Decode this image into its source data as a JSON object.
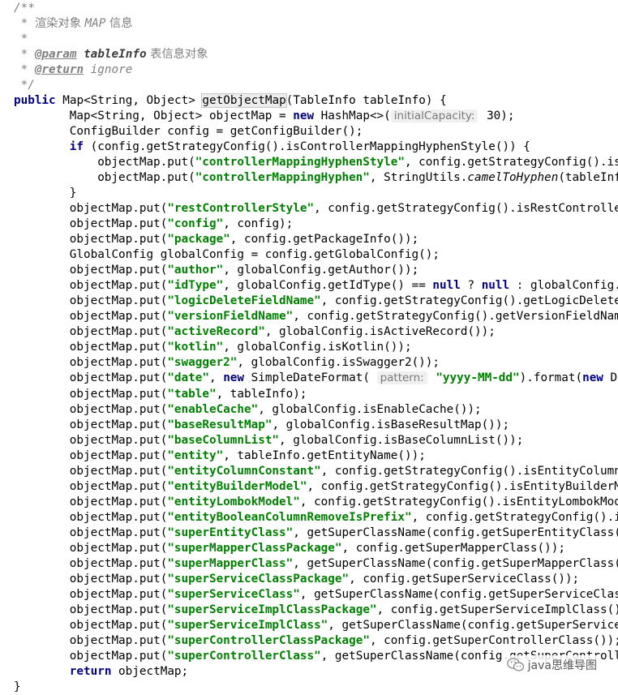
{
  "colors": {
    "keyword": "#000080",
    "string": "#008000",
    "comment": "#808080",
    "hint_background": "#f0f0f0",
    "highlight_background": "#ededed"
  },
  "watermark": {
    "text": "java思维导图",
    "icon": "wechat-icon"
  },
  "code": [
    {
      "indent": 0,
      "tokens": [
        {
          "t": "/**",
          "c": "c"
        }
      ]
    },
    {
      "indent": 1,
      "tokens": [
        {
          "t": "* ",
          "c": "c"
        },
        {
          "t": "渲染对象 ",
          "c": "cj"
        },
        {
          "t": "MAP",
          "c": "c"
        },
        {
          "t": " 信息",
          "c": "cj"
        }
      ]
    },
    {
      "indent": 1,
      "tokens": [
        {
          "t": "*",
          "c": "c"
        }
      ]
    },
    {
      "indent": 1,
      "tokens": [
        {
          "t": "* ",
          "c": "c"
        },
        {
          "t": "@param",
          "c": "ct"
        },
        {
          "t": " ",
          "c": "c"
        },
        {
          "t": "tableInfo",
          "c": "cb"
        },
        {
          "t": " 表信息对象",
          "c": "cj"
        }
      ]
    },
    {
      "indent": 1,
      "tokens": [
        {
          "t": "* ",
          "c": "c"
        },
        {
          "t": "@return",
          "c": "ct"
        },
        {
          "t": " ignore",
          "c": "c"
        }
      ]
    },
    {
      "indent": 1,
      "tokens": [
        {
          "t": "*/",
          "c": "c"
        }
      ]
    },
    {
      "indent": 0,
      "tokens": [
        {
          "t": "public",
          "c": "k"
        },
        {
          "t": " Map<String, Object> "
        },
        {
          "t": "caret",
          "c": "caret"
        },
        {
          "t": "getObjectMap",
          "c": "hl"
        },
        {
          "t": "(TableInfo tableInfo) {"
        }
      ]
    },
    {
      "indent": 8,
      "tokens": [
        {
          "t": "Map<String, Object> objectMap = "
        },
        {
          "t": "new",
          "c": "k"
        },
        {
          "t": " HashMap<>("
        },
        {
          "t": "initialCapacity:",
          "c": "hint"
        },
        {
          "t": " 30);"
        }
      ]
    },
    {
      "indent": 8,
      "tokens": [
        {
          "t": "ConfigBuilder config = getConfigBuilder();"
        }
      ]
    },
    {
      "indent": 8,
      "tokens": [
        {
          "t": "if",
          "c": "k"
        },
        {
          "t": " (config.getStrategyConfig().isControllerMappingHyphenStyle()) {"
        }
      ]
    },
    {
      "indent": 12,
      "tokens": [
        {
          "t": "objectMap.put("
        },
        {
          "t": "\"controllerMappingHyphenStyle\"",
          "c": "s"
        },
        {
          "t": ", config.getStrategyConfig().isControllerMappingHyphenStyle());"
        }
      ]
    },
    {
      "indent": 12,
      "tokens": [
        {
          "t": "objectMap.put("
        },
        {
          "t": "\"controllerMappingHyphen\"",
          "c": "s"
        },
        {
          "t": ", StringUtils."
        },
        {
          "t": "camelToHyphen",
          "c": "i"
        },
        {
          "t": "(tableInfo.getEntityPath()));"
        }
      ]
    },
    {
      "indent": 8,
      "tokens": [
        {
          "t": "}"
        }
      ]
    },
    {
      "indent": 8,
      "tokens": [
        {
          "t": "objectMap.put("
        },
        {
          "t": "\"restControllerStyle\"",
          "c": "s"
        },
        {
          "t": ", config.getStrategyConfig().isRestControllerStyle());"
        }
      ]
    },
    {
      "indent": 8,
      "tokens": [
        {
          "t": "objectMap.put("
        },
        {
          "t": "\"config\"",
          "c": "s"
        },
        {
          "t": ", config);"
        }
      ]
    },
    {
      "indent": 8,
      "tokens": [
        {
          "t": "objectMap.put("
        },
        {
          "t": "\"package\"",
          "c": "s"
        },
        {
          "t": ", config.getPackageInfo());"
        }
      ]
    },
    {
      "indent": 8,
      "tokens": [
        {
          "t": "GlobalConfig globalConfig = config.getGlobalConfig();"
        }
      ]
    },
    {
      "indent": 8,
      "tokens": [
        {
          "t": "objectMap.put("
        },
        {
          "t": "\"author\"",
          "c": "s"
        },
        {
          "t": ", globalConfig.getAuthor());"
        }
      ]
    },
    {
      "indent": 8,
      "tokens": [
        {
          "t": "objectMap.put("
        },
        {
          "t": "\"idType\"",
          "c": "s"
        },
        {
          "t": ", globalConfig.getIdType() == "
        },
        {
          "t": "null",
          "c": "k"
        },
        {
          "t": " ? "
        },
        {
          "t": "null",
          "c": "k"
        },
        {
          "t": " : globalConfig.getIdType().toString());"
        }
      ]
    },
    {
      "indent": 8,
      "tokens": [
        {
          "t": "objectMap.put("
        },
        {
          "t": "\"logicDeleteFieldName\"",
          "c": "s"
        },
        {
          "t": ", config.getStrategyConfig().getLogicDeleteFieldName());"
        }
      ]
    },
    {
      "indent": 8,
      "tokens": [
        {
          "t": "objectMap.put("
        },
        {
          "t": "\"versionFieldName\"",
          "c": "s"
        },
        {
          "t": ", config.getStrategyConfig().getVersionFieldName());"
        }
      ]
    },
    {
      "indent": 8,
      "tokens": [
        {
          "t": "objectMap.put("
        },
        {
          "t": "\"activeRecord\"",
          "c": "s"
        },
        {
          "t": ", globalConfig.isActiveRecord());"
        }
      ]
    },
    {
      "indent": 8,
      "tokens": [
        {
          "t": "objectMap.put("
        },
        {
          "t": "\"kotlin\"",
          "c": "s"
        },
        {
          "t": ", globalConfig.isKotlin());"
        }
      ]
    },
    {
      "indent": 8,
      "tokens": [
        {
          "t": "objectMap.put("
        },
        {
          "t": "\"swagger2\"",
          "c": "s"
        },
        {
          "t": ", globalConfig.isSwagger2());"
        }
      ]
    },
    {
      "indent": 8,
      "tokens": [
        {
          "t": "objectMap.put("
        },
        {
          "t": "\"date\"",
          "c": "s"
        },
        {
          "t": ", "
        },
        {
          "t": "new",
          "c": "k"
        },
        {
          "t": " SimpleDateFormat( "
        },
        {
          "t": "pattern:",
          "c": "hint"
        },
        {
          "t": " "
        },
        {
          "t": "\"yyyy-MM-dd\"",
          "c": "s"
        },
        {
          "t": ").format("
        },
        {
          "t": "new",
          "c": "k"
        },
        {
          "t": " Date()));"
        }
      ]
    },
    {
      "indent": 8,
      "tokens": [
        {
          "t": "objectMap.put("
        },
        {
          "t": "\"table\"",
          "c": "s"
        },
        {
          "t": ", tableInfo);"
        }
      ]
    },
    {
      "indent": 8,
      "tokens": [
        {
          "t": "objectMap.put("
        },
        {
          "t": "\"enableCache\"",
          "c": "s"
        },
        {
          "t": ", globalConfig.isEnableCache());"
        }
      ]
    },
    {
      "indent": 8,
      "tokens": [
        {
          "t": "objectMap.put("
        },
        {
          "t": "\"baseResultMap\"",
          "c": "s"
        },
        {
          "t": ", globalConfig.isBaseResultMap());"
        }
      ]
    },
    {
      "indent": 8,
      "tokens": [
        {
          "t": "objectMap.put("
        },
        {
          "t": "\"baseColumnList\"",
          "c": "s"
        },
        {
          "t": ", globalConfig.isBaseColumnList());"
        }
      ]
    },
    {
      "indent": 8,
      "tokens": [
        {
          "t": "objectMap.put("
        },
        {
          "t": "\"entity\"",
          "c": "s"
        },
        {
          "t": ", tableInfo.getEntityName());"
        }
      ]
    },
    {
      "indent": 8,
      "tokens": [
        {
          "t": "objectMap.put("
        },
        {
          "t": "\"entityColumnConstant\"",
          "c": "s"
        },
        {
          "t": ", config.getStrategyConfig().isEntityColumnConstant());"
        }
      ]
    },
    {
      "indent": 8,
      "tokens": [
        {
          "t": "objectMap.put("
        },
        {
          "t": "\"entityBuilderModel\"",
          "c": "s"
        },
        {
          "t": ", config.getStrategyConfig().isEntityBuilderModel());"
        }
      ]
    },
    {
      "indent": 8,
      "tokens": [
        {
          "t": "objectMap.put("
        },
        {
          "t": "\"entityLombokModel\"",
          "c": "s"
        },
        {
          "t": ", config.getStrategyConfig().isEntityLombokModel());"
        }
      ]
    },
    {
      "indent": 8,
      "tokens": [
        {
          "t": "objectMap.put("
        },
        {
          "t": "\"entityBooleanColumnRemoveIsPrefix\"",
          "c": "s"
        },
        {
          "t": ", config.getStrategyConfig().isEntityBooleanColumnRemoveIsPrefix());"
        }
      ]
    },
    {
      "indent": 8,
      "tokens": [
        {
          "t": "objectMap.put("
        },
        {
          "t": "\"superEntityClass\"",
          "c": "s"
        },
        {
          "t": ", getSuperClassName(config.getSuperEntityClass()));"
        }
      ]
    },
    {
      "indent": 8,
      "tokens": [
        {
          "t": "objectMap.put("
        },
        {
          "t": "\"superMapperClassPackage\"",
          "c": "s"
        },
        {
          "t": ", config.getSuperMapperClass());"
        }
      ]
    },
    {
      "indent": 8,
      "tokens": [
        {
          "t": "objectMap.put("
        },
        {
          "t": "\"superMapperClass\"",
          "c": "s"
        },
        {
          "t": ", getSuperClassName(config.getSuperMapperClass()));"
        }
      ]
    },
    {
      "indent": 8,
      "tokens": [
        {
          "t": "objectMap.put("
        },
        {
          "t": "\"superServiceClassPackage\"",
          "c": "s"
        },
        {
          "t": ", config.getSuperServiceClass());"
        }
      ]
    },
    {
      "indent": 8,
      "tokens": [
        {
          "t": "objectMap.put("
        },
        {
          "t": "\"superServiceClass\"",
          "c": "s"
        },
        {
          "t": ", getSuperClassName(config.getSuperServiceClass()));"
        }
      ]
    },
    {
      "indent": 8,
      "tokens": [
        {
          "t": "objectMap.put("
        },
        {
          "t": "\"superServiceImplClassPackage\"",
          "c": "s"
        },
        {
          "t": ", config.getSuperServiceImplClass());"
        }
      ]
    },
    {
      "indent": 8,
      "tokens": [
        {
          "t": "objectMap.put("
        },
        {
          "t": "\"superServiceImplClass\"",
          "c": "s"
        },
        {
          "t": ", getSuperClassName(config.getSuperServiceImplClass()));"
        }
      ]
    },
    {
      "indent": 8,
      "tokens": [
        {
          "t": "objectMap.put("
        },
        {
          "t": "\"superControllerClassPackage\"",
          "c": "s"
        },
        {
          "t": ", config.getSuperControllerClass());"
        }
      ]
    },
    {
      "indent": 8,
      "tokens": [
        {
          "t": "objectMap.put("
        },
        {
          "t": "\"superControllerClass\"",
          "c": "s"
        },
        {
          "t": ", getSuperClassName(config.getSuperControllerClass()));"
        }
      ]
    },
    {
      "indent": 8,
      "tokens": [
        {
          "t": "return",
          "c": "k"
        },
        {
          "t": " objectMap;"
        }
      ]
    },
    {
      "indent": 0,
      "tokens": [
        {
          "t": "}"
        }
      ]
    }
  ]
}
